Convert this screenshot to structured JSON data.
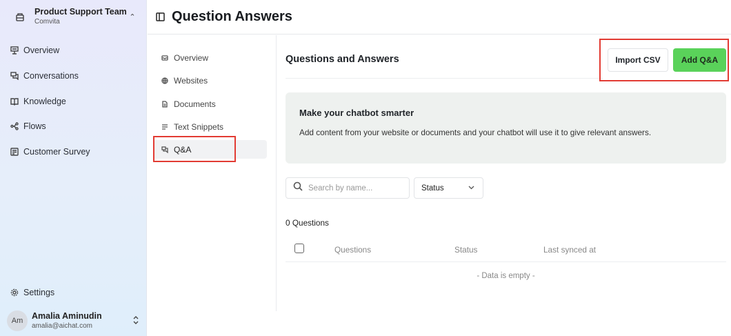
{
  "sidebar": {
    "team": {
      "name": "Product Support Team",
      "org": "Comvita",
      "icon": "briefcase-icon"
    },
    "items": [
      {
        "label": "Overview",
        "icon": "presentation-icon"
      },
      {
        "label": "Conversations",
        "icon": "chat-icon"
      },
      {
        "label": "Knowledge",
        "icon": "book-icon"
      },
      {
        "label": "Flows",
        "icon": "flow-icon"
      },
      {
        "label": "Customer Survey",
        "icon": "survey-icon"
      }
    ],
    "settings": {
      "label": "Settings",
      "icon": "gear-icon"
    },
    "user": {
      "initials": "Am",
      "name": "Amalia Aminudin",
      "email": "amalia@aichat.com"
    }
  },
  "header": {
    "title": "Question Answers",
    "icon": "panel-toggle-icon"
  },
  "subnav": {
    "items": [
      {
        "label": "Overview",
        "icon": "inbox-icon"
      },
      {
        "label": "Websites",
        "icon": "globe-icon"
      },
      {
        "label": "Documents",
        "icon": "document-icon"
      },
      {
        "label": "Text Snippets",
        "icon": "text-icon"
      },
      {
        "label": "Q&A",
        "icon": "qa-icon",
        "active": true
      }
    ]
  },
  "main": {
    "section_title": "Questions and Answers",
    "import_label": "Import CSV",
    "add_label": "Add Q&A",
    "info": {
      "title": "Make your chatbot smarter",
      "body": "Add content from your website or documents and your chatbot will use it to give relevant answers."
    },
    "search": {
      "placeholder": "Search by name..."
    },
    "status_filter": {
      "value": "Status"
    },
    "count_text": "0 Questions",
    "table": {
      "headers": [
        "Questions",
        "Status",
        "Last synced at"
      ],
      "empty_text": "- Data is empty -"
    }
  },
  "colors": {
    "accent_green": "#5ad25a",
    "highlight_red": "#e23b33"
  }
}
